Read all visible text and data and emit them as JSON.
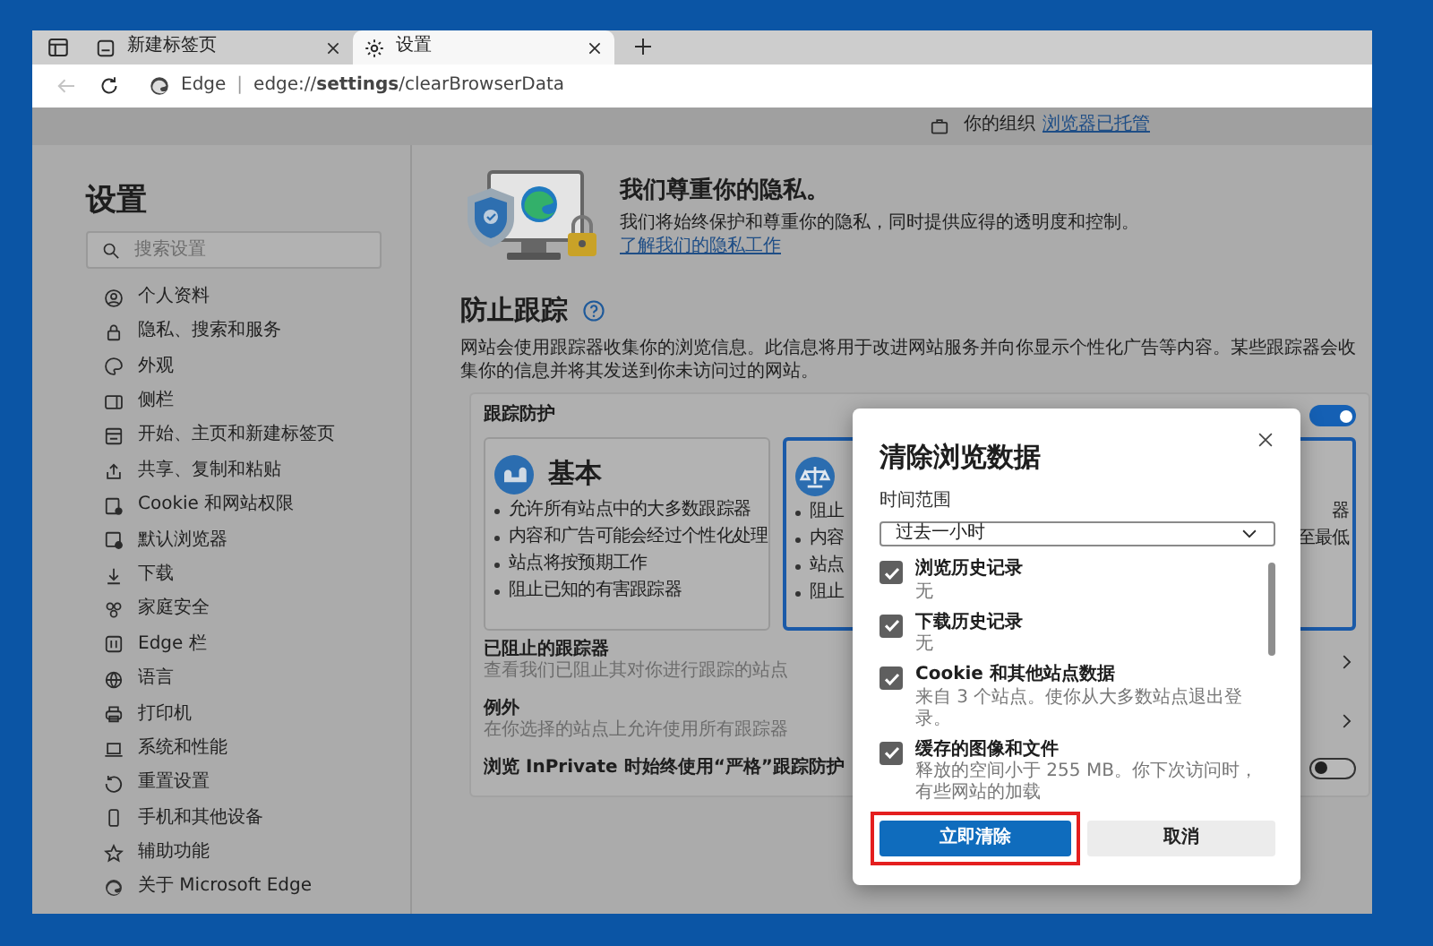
{
  "tab_strip": {
    "tabs": [
      {
        "title": "新建标签页",
        "selected": false
      },
      {
        "title": "设置",
        "selected": true
      }
    ]
  },
  "address_bar": {
    "back_disabled": true,
    "site_label": "Edge",
    "separator": "|",
    "url": "edge://**settings**/clearBrowserData"
  },
  "managed_notice": {
    "text": "你的组织",
    "link": "浏览器已托管"
  },
  "sidebar": {
    "title": "设置",
    "search": {
      "placeholder": "搜索设置"
    },
    "items": [
      {
        "label": "个人资料"
      },
      {
        "label": "隐私、搜索和服务"
      },
      {
        "label": "外观"
      },
      {
        "label": "侧栏"
      },
      {
        "label": "开始、主页和新建标签页"
      },
      {
        "label": "共享、复制和粘贴"
      },
      {
        "label": "Cookie 和网站权限"
      },
      {
        "label": "默认浏览器"
      },
      {
        "label": "下载"
      },
      {
        "label": "家庭安全"
      },
      {
        "label": "Edge 栏"
      },
      {
        "label": "语言"
      },
      {
        "label": "打印机"
      },
      {
        "label": "系统和性能"
      },
      {
        "label": "重置设置"
      },
      {
        "label": "手机和其他设备"
      },
      {
        "label": "辅助功能"
      },
      {
        "label": "关于 Microsoft Edge"
      }
    ]
  },
  "privacy_intro": {
    "heading": "我们尊重你的隐私。",
    "text": "我们将始终保护和尊重你的隐私，同时提供应得的透明度和控制。",
    "link": "了解我们的隐私工作"
  },
  "tracking": {
    "heading": "防止跟踪",
    "description": "网站会使用跟踪器收集你的浏览信息。此信息将用于改进网站服务并向你显示个性化广告等内容。某些跟踪器会收集你的信息并将其发送到你未访问过的网站。",
    "panel": {
      "title": "跟踪防护",
      "on": true,
      "levels": [
        {
          "title": "基本",
          "selected": false,
          "points": [
            {
              "left": "允许所有站点中的大多数跟踪器"
            },
            {
              "left": "内容和广告可能会经过个性化处理"
            },
            {
              "left": "站点将按预期工作"
            },
            {
              "left": "阻止已知的有害跟踪器"
            }
          ]
        },
        {
          "selected": true,
          "points": [
            {
              "left": "阻止",
              "right": "器"
            },
            {
              "left": "内容",
              "right": "至最低"
            },
            {
              "left": "站点"
            },
            {
              "left": "阻止"
            }
          ]
        }
      ],
      "rows": [
        {
          "kind": "link",
          "title": "已阻止的跟踪器",
          "subtitle": "查看我们已阻止其对你进行跟踪的站点"
        },
        {
          "kind": "link",
          "title": "例外",
          "subtitle": "在你选择的站点上允许使用所有跟踪器"
        },
        {
          "kind": "toggle",
          "title": "浏览 InPrivate 时始终使用“严格”跟踪防护",
          "on": false
        }
      ]
    }
  },
  "dialog": {
    "title": "清除浏览数据",
    "range_label": "时间范围",
    "range_value": "过去一小时",
    "items": [
      {
        "label": "浏览历史记录",
        "detail": "无",
        "checked": true
      },
      {
        "label": "下载历史记录",
        "detail": "无",
        "checked": true
      },
      {
        "label": "Cookie 和其他站点数据",
        "detail": "来自 3 个站点。使你从大多数站点退出登录。",
        "checked": true
      },
      {
        "label": "缓存的图像和文件",
        "detail": "释放的空间小于 255 MB。你下次访问时，有些网站的加载",
        "checked": true
      }
    ],
    "buttons": [
      {
        "label": "立即清除",
        "kind": "primary",
        "highlighted": true
      },
      {
        "label": "取消",
        "kind": "secondary",
        "highlighted": false
      }
    ]
  }
}
